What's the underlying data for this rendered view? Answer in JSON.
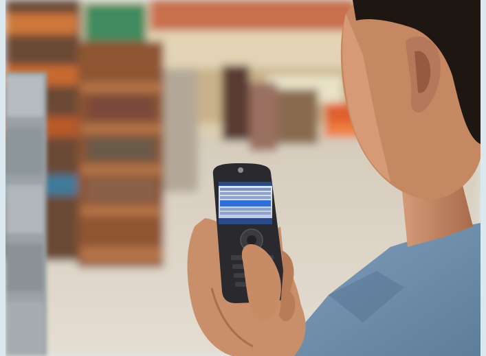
{
  "photo": {
    "setting": "store-aisle",
    "colors": {
      "frame": "#dce8f0",
      "floor": "#d9cfc0",
      "shelf_wood": "#a8643a",
      "skin": "#c98f6a",
      "shirt": "#6f8fad",
      "hair": "#1e1610",
      "phone_body": "#2a2a2e",
      "screen_highlight": "#2f6fd6"
    }
  }
}
